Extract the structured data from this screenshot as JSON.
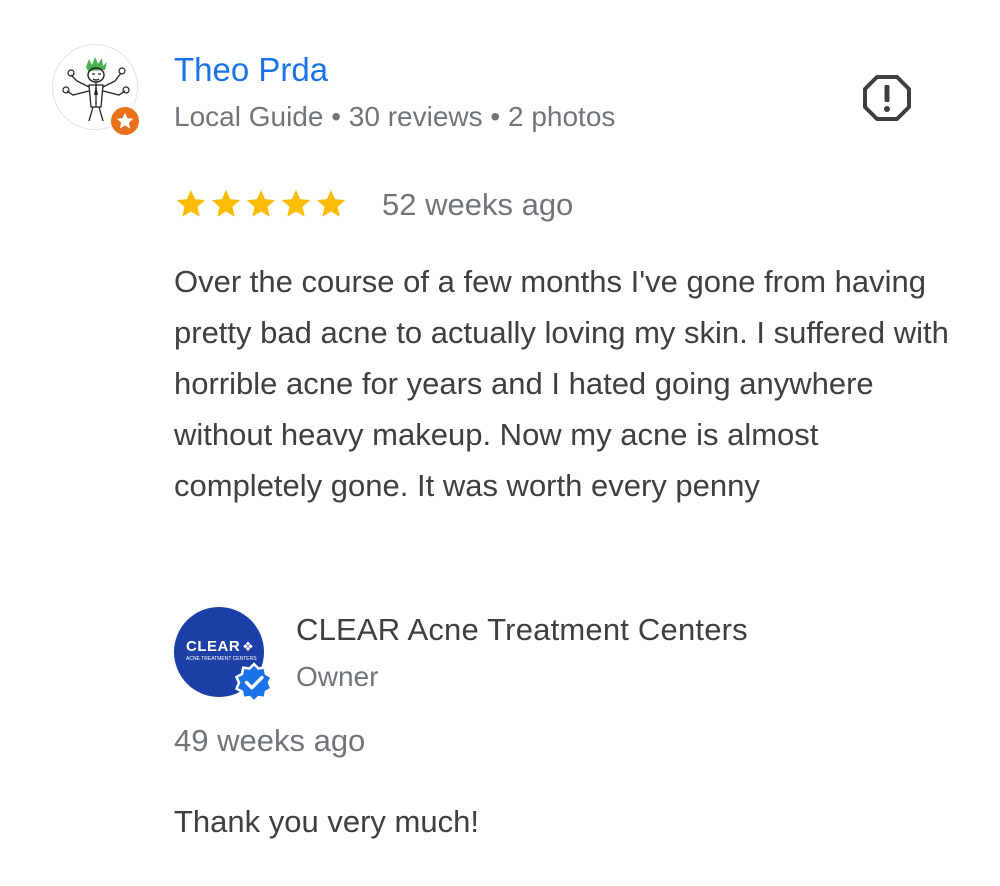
{
  "reviewer": {
    "name": "Theo Prda",
    "meta": "Local Guide • 30 reviews • 2 photos",
    "avatar_icon": "sketch-avatar-icon",
    "badge_icon": "local-guide-star-icon"
  },
  "report": {
    "icon": "report-icon"
  },
  "review": {
    "rating": 5,
    "max_rating": 5,
    "time": "52 weeks ago",
    "text": "Over the course of a few months I've gone from having pretty bad acne to actually loving my skin. I suffered with horrible acne for years and I hated going anywhere without heavy makeup. Now my acne is almost completely gone. It was worth every penny"
  },
  "owner": {
    "name": "CLEAR Acne Treatment Centers",
    "role": "Owner",
    "logo_text": "CLEAR",
    "logo_subtext": "ACNE TREATMENT CENTERS",
    "verified_icon": "verified-check-icon",
    "response_time": "49 weeks ago",
    "response_text": "Thank you very much!"
  },
  "colors": {
    "name_blue": "#1a73e8",
    "star_yellow": "#fbbc04",
    "guide_orange": "#e8711c",
    "owner_blue": "#1d3fa8",
    "verified_blue": "#1a73e8",
    "text_dark": "#3c4043",
    "text_gray": "#70757a"
  }
}
